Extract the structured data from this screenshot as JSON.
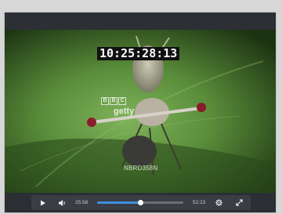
{
  "player": {
    "title": "",
    "video": {
      "timecode": "10:25:28:13",
      "watermark_letters": [
        "B",
        "B",
        "C"
      ],
      "watermark_text": "getty",
      "clip_id": "NBRD358N"
    },
    "controls": {
      "play_icon": "play-icon",
      "volume_icon": "volume-icon",
      "current_time": "25:58",
      "duration": "52:23",
      "progress": 0.5,
      "settings_icon": "gear-icon",
      "fullscreen_icon": "fullscreen-icon",
      "accent_color": "#3e8fe0"
    }
  }
}
